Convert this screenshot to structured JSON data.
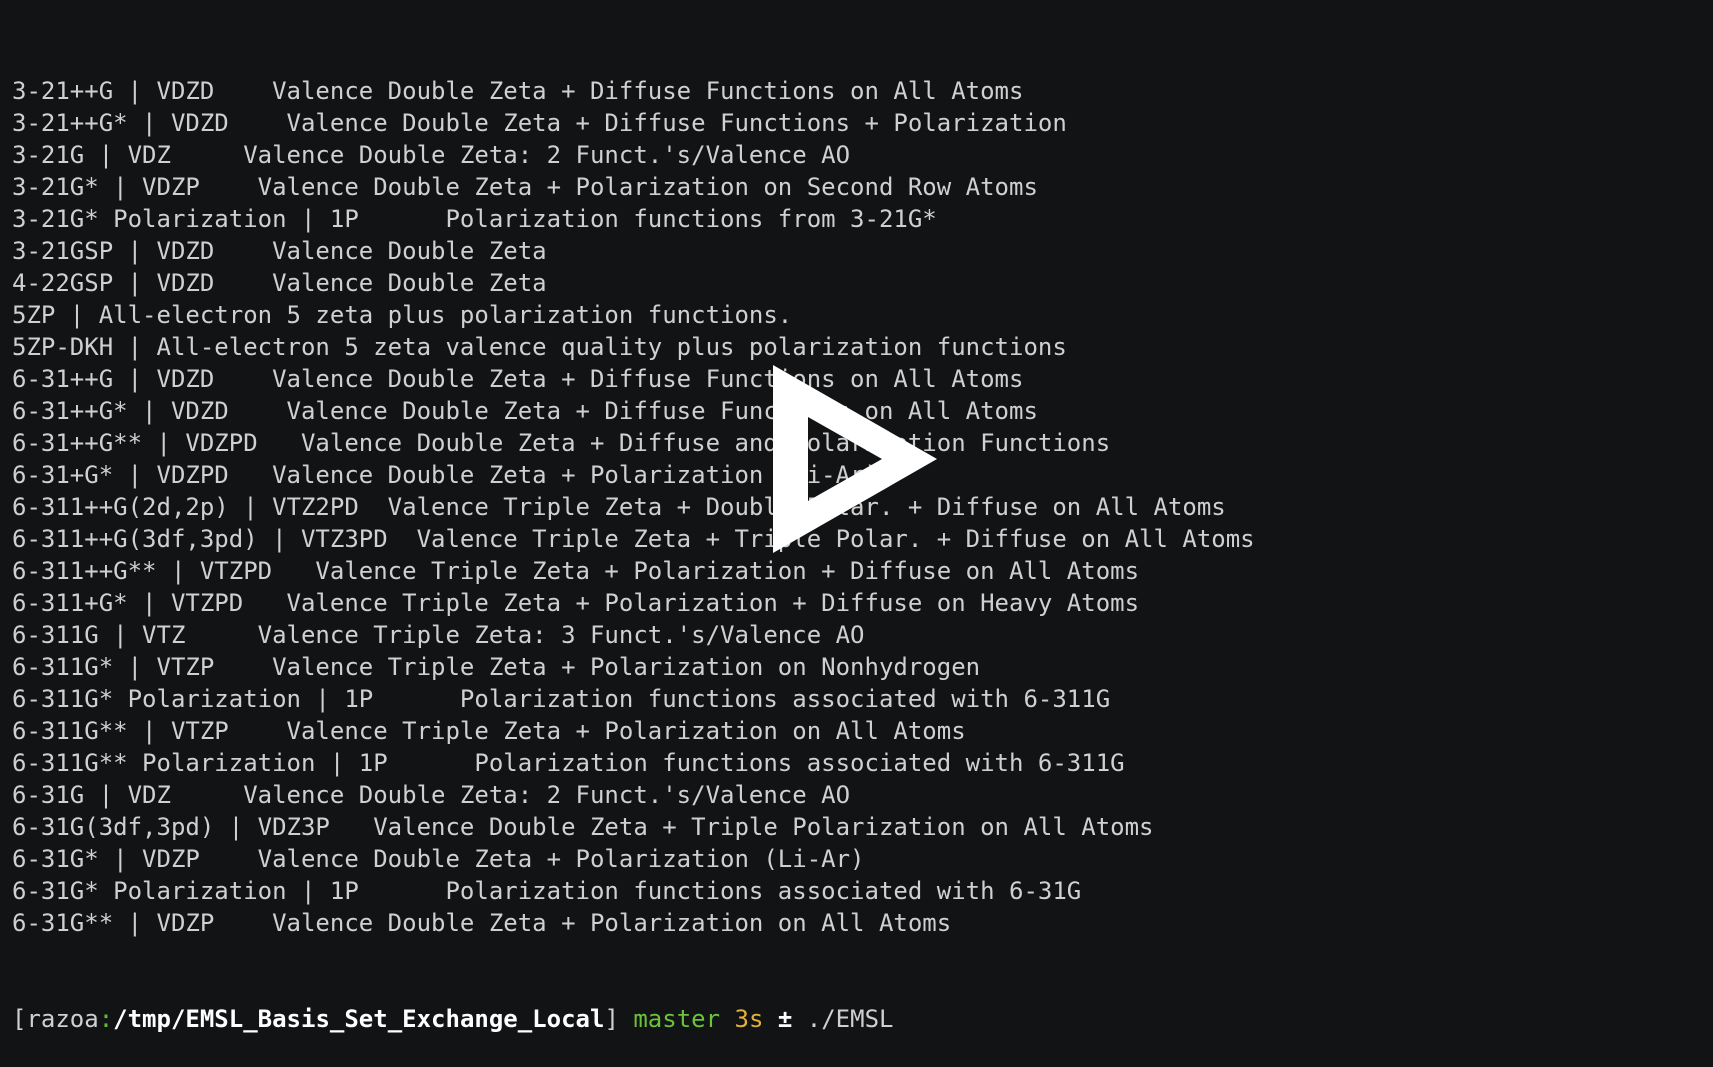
{
  "terminal": {
    "lines": [
      "3-21++G | VDZD    Valence Double Zeta + Diffuse Functions on All Atoms",
      "3-21++G* | VDZD    Valence Double Zeta + Diffuse Functions + Polarization",
      "3-21G | VDZ     Valence Double Zeta: 2 Funct.'s/Valence AO",
      "3-21G* | VDZP    Valence Double Zeta + Polarization on Second Row Atoms",
      "3-21G* Polarization | 1P      Polarization functions from 3-21G*",
      "3-21GSP | VDZD    Valence Double Zeta",
      "4-22GSP | VDZD    Valence Double Zeta",
      "5ZP | All-electron 5 zeta plus polarization functions.",
      "5ZP-DKH | All-electron 5 zeta valence quality plus polarization functions",
      "6-31++G | VDZD    Valence Double Zeta + Diffuse Functions on All Atoms",
      "6-31++G* | VDZD    Valence Double Zeta + Diffuse Functions on All Atoms",
      "6-31++G** | VDZPD   Valence Double Zeta + Diffuse and Polarization Functions",
      "6-31+G* | VDZPD   Valence Double Zeta + Polarization (Li-Ar)",
      "6-311++G(2d,2p) | VTZ2PD  Valence Triple Zeta + Double Polar. + Diffuse on All Atoms",
      "6-311++G(3df,3pd) | VTZ3PD  Valence Triple Zeta + Triple Polar. + Diffuse on All Atoms",
      "6-311++G** | VTZPD   Valence Triple Zeta + Polarization + Diffuse on All Atoms",
      "6-311+G* | VTZPD   Valence Triple Zeta + Polarization + Diffuse on Heavy Atoms",
      "6-311G | VTZ     Valence Triple Zeta: 3 Funct.'s/Valence AO",
      "6-311G* | VTZP    Valence Triple Zeta + Polarization on Nonhydrogen",
      "6-311G* Polarization | 1P      Polarization functions associated with 6-311G",
      "6-311G** | VTZP    Valence Triple Zeta + Polarization on All Atoms",
      "6-311G** Polarization | 1P      Polarization functions associated with 6-311G",
      "6-31G | VDZ     Valence Double Zeta: 2 Funct.'s/Valence AO",
      "6-31G(3df,3pd) | VDZ3P   Valence Double Zeta + Triple Polarization on All Atoms",
      "6-31G* | VDZP    Valence Double Zeta + Polarization (Li-Ar)",
      "6-31G* Polarization | 1P      Polarization functions associated with 6-31G",
      "6-31G** | VDZP    Valence Double Zeta + Polarization on All Atoms"
    ],
    "prompt": {
      "open_bracket": "[",
      "host": "razoa",
      "colon": ":",
      "path": "/tmp/EMSL_Basis_Set_Exchange_Local",
      "close_bracket": "]",
      "branch": "master",
      "elapsed": "3s",
      "dirty_marker": "±",
      "command": "./EMSL"
    }
  },
  "overlay": {
    "icon": "play-icon",
    "color": "#ffffff"
  }
}
